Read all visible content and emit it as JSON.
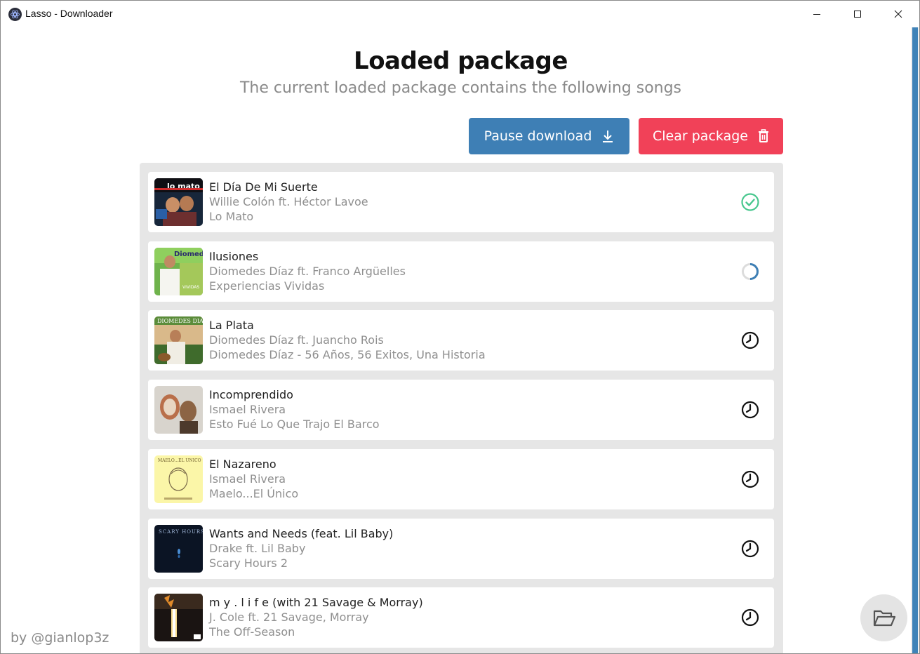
{
  "window": {
    "title": "Lasso - Downloader"
  },
  "header": {
    "title": "Loaded package",
    "subtitle": "The current loaded package contains the following songs"
  },
  "actions": {
    "pause_label": "Pause download",
    "clear_label": "Clear package"
  },
  "songs": [
    {
      "title": "El Día De Mi Suerte",
      "artist": "Willie Colón ft. Héctor Lavoe",
      "album": "Lo Mato",
      "status": "done"
    },
    {
      "title": "Ilusiones",
      "artist": "Diomedes Díaz ft. Franco Argüelles",
      "album": "Experiencias Vividas",
      "status": "downloading"
    },
    {
      "title": "La Plata",
      "artist": "Diomedes Díaz ft. Juancho Rois",
      "album": "Diomedes Díaz - 56 Años, 56 Exitos, Una Historia",
      "status": "pending"
    },
    {
      "title": "Incomprendido",
      "artist": "Ismael Rivera",
      "album": "Esto Fué Lo Que Trajo El Barco",
      "status": "pending"
    },
    {
      "title": "El Nazareno",
      "artist": "Ismael Rivera",
      "album": "Maelo...El Único",
      "status": "pending"
    },
    {
      "title": "Wants and Needs (feat. Lil Baby)",
      "artist": "Drake ft. Lil Baby",
      "album": "Scary Hours 2",
      "status": "pending"
    },
    {
      "title": "m y . l i f e (with 21 Savage & Morray)",
      "artist": "J. Cole ft. 21 Savage, Morray",
      "album": "The Off-Season",
      "status": "pending"
    }
  ],
  "footer": {
    "author": "by @gianlop3z"
  },
  "colors": {
    "primary": "#3e7fb5",
    "danger": "#f14158",
    "success": "#48c78e",
    "list_bg": "#e6e6e6"
  },
  "icons": {
    "pause": "download-arrow-icon",
    "clear": "trash-icon",
    "done": "check-circle-icon",
    "downloading": "spinner-icon",
    "pending": "clock-icon",
    "open": "folder-open-icon"
  }
}
